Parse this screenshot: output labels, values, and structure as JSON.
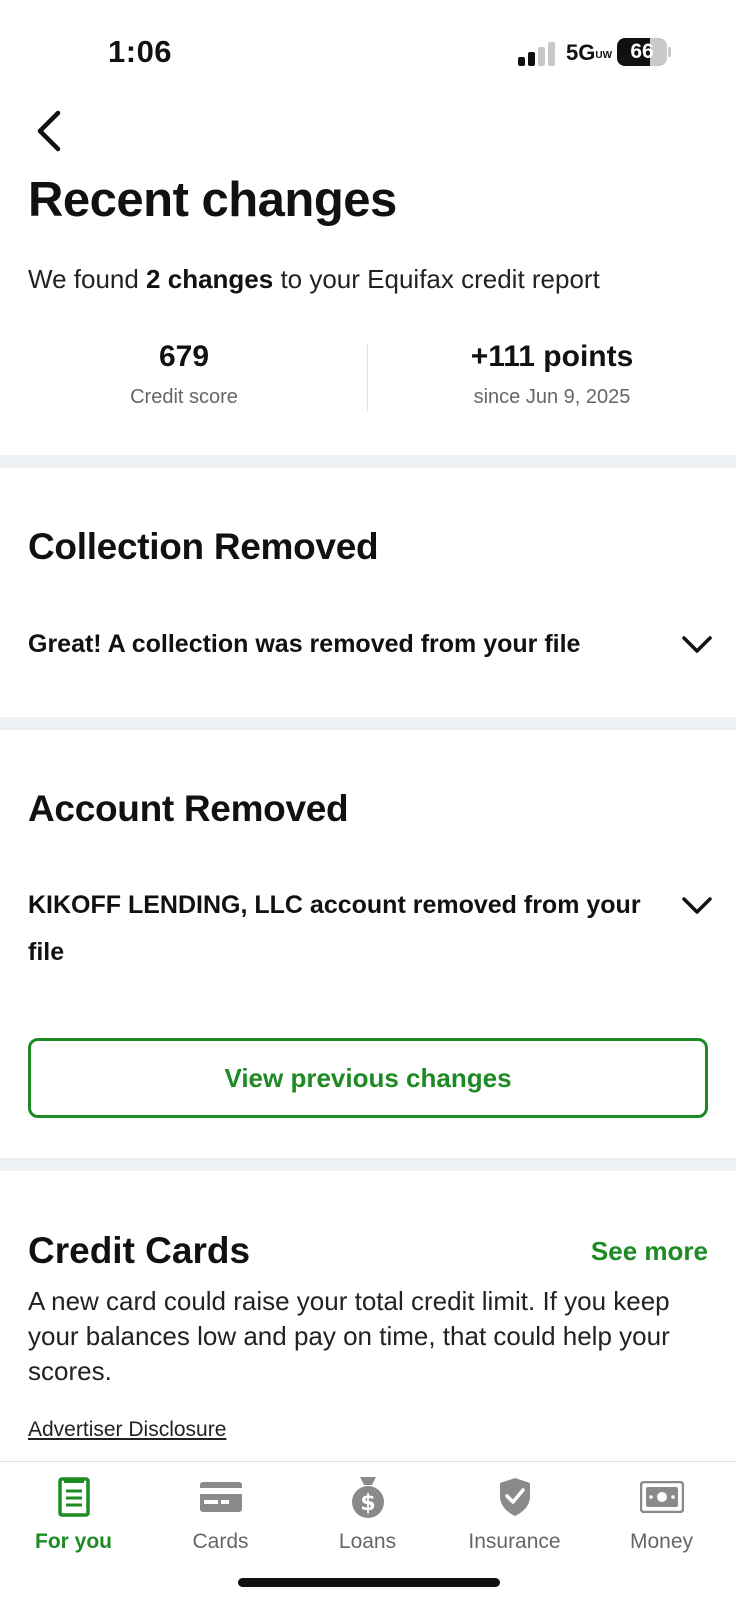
{
  "status_bar": {
    "time": "1:06",
    "network": "5G",
    "network_badge": "UW",
    "battery_percent": "66",
    "battery_level": 0.66
  },
  "header": {
    "back_icon": "chevron-left-icon",
    "title": "Recent changes",
    "subtitle_prefix": "We found ",
    "subtitle_bold": "2 changes",
    "subtitle_suffix": " to your Equifax credit report"
  },
  "stats": {
    "score_value": "679",
    "score_label": "Credit score",
    "change_value": "+111 points",
    "change_label": "since Jun 9, 2025"
  },
  "sections": [
    {
      "title": "Collection Removed",
      "text": "Great! A collection was removed from your file",
      "icon": "chevron-down-icon"
    },
    {
      "title": "Account Removed",
      "text": "KIKOFF LENDING, LLC account removed from your file",
      "icon": "chevron-down-icon"
    }
  ],
  "view_previous_button": "View previous changes",
  "credit_cards": {
    "title": "Credit Cards",
    "see_more": "See more",
    "description": "A new card could raise your total credit limit. If you keep your balances low and pay on time, that could help your scores.",
    "disclosure": "Advertiser Disclosure"
  },
  "bottom_nav": [
    {
      "label": "For you",
      "icon": "document-icon",
      "active": true
    },
    {
      "label": "Cards",
      "icon": "credit-card-icon",
      "active": false
    },
    {
      "label": "Loans",
      "icon": "money-bag-icon",
      "active": false
    },
    {
      "label": "Insurance",
      "icon": "shield-check-icon",
      "active": false
    },
    {
      "label": "Money",
      "icon": "banknote-icon",
      "active": false
    }
  ],
  "colors": {
    "accent_green": "#1e8a23",
    "separator": "#eef1f3",
    "muted_text": "#666666"
  }
}
